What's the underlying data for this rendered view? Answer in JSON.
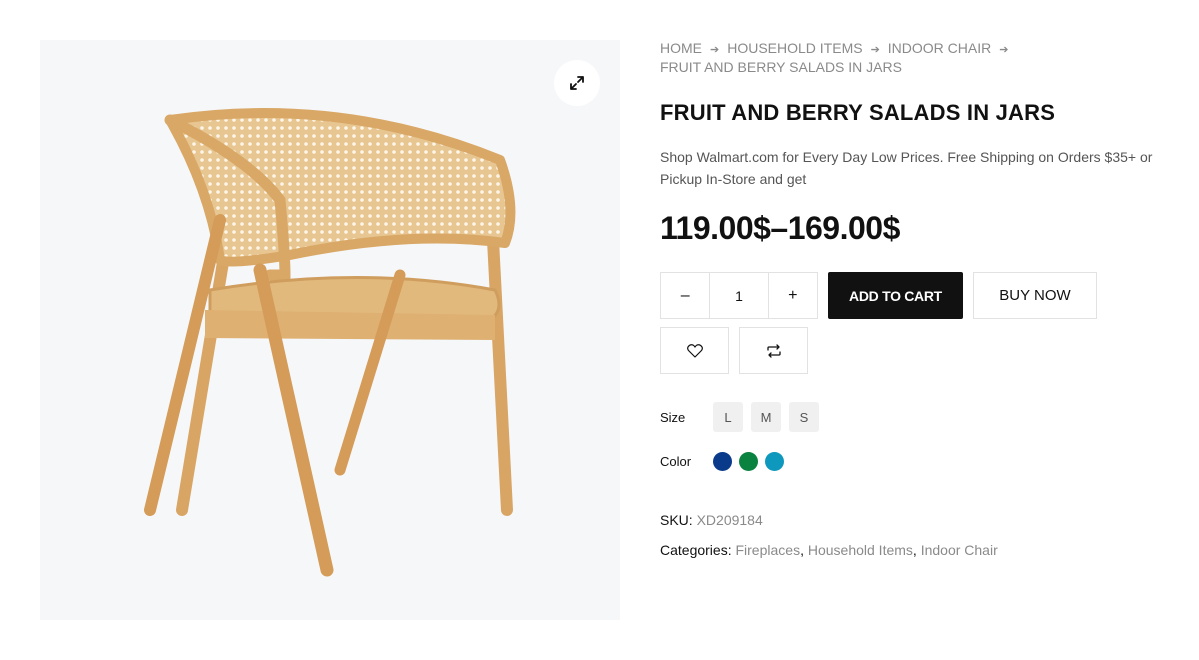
{
  "breadcrumb": [
    "HOME",
    "HOUSEHOLD ITEMS",
    "INDOOR CHAIR",
    "FRUIT AND BERRY SALADS IN JARS"
  ],
  "product": {
    "title": "FRUIT AND BERRY SALADS IN JARS",
    "description": "Shop Walmart.com for Every Day Low Prices. Free Shipping on Orders $35+ or Pickup In-Store and get",
    "price": "119.00$–169.00$",
    "quantity": "1",
    "sku_label": "SKU:",
    "sku": "XD209184",
    "categories_label": "Categories:",
    "categories": [
      "Fireplaces",
      "Household Items",
      "Indoor Chair"
    ]
  },
  "actions": {
    "minus": "–",
    "plus": "+",
    "add_to_cart": "ADD TO CART",
    "buy_now": "BUY NOW",
    "wishlist_icon": "heart-icon",
    "compare_icon": "compare-arrows-icon",
    "zoom_icon": "expand-icon"
  },
  "attributes": {
    "size_label": "Size",
    "sizes": [
      "L",
      "M",
      "S"
    ],
    "color_label": "Color",
    "colors": [
      "#0a3b8a",
      "#0a8240",
      "#0e98bd"
    ]
  }
}
